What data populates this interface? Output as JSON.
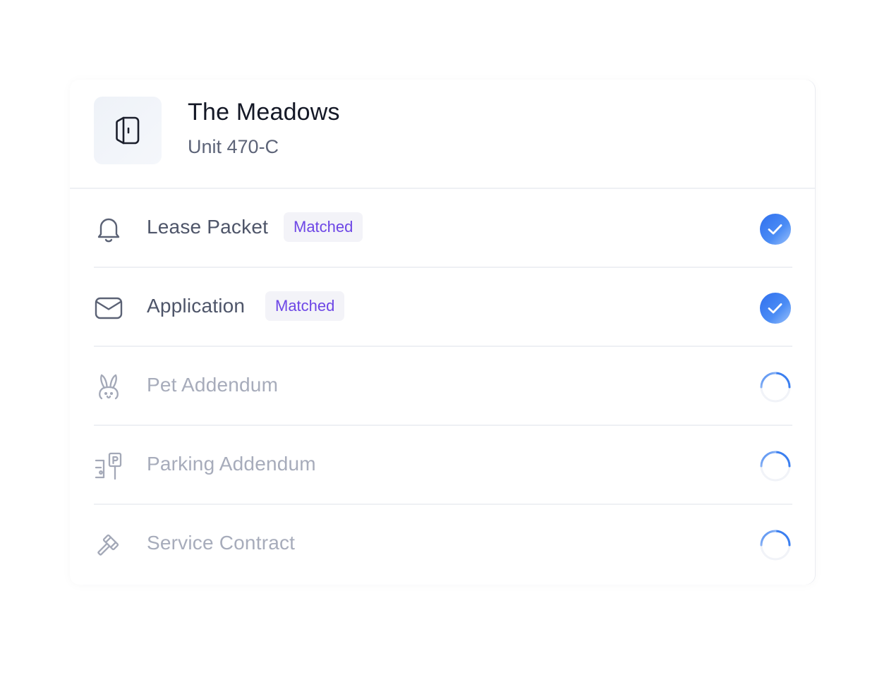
{
  "property": {
    "name": "The Meadows",
    "unit": "Unit 470-C",
    "icon": "door-icon"
  },
  "documents": [
    {
      "label": "Lease Packet",
      "icon": "bell-icon",
      "badge": "Matched",
      "status": "complete"
    },
    {
      "label": "Application",
      "icon": "envelope-icon",
      "badge": "Matched",
      "status": "complete"
    },
    {
      "label": "Pet Addendum",
      "icon": "rabbit-icon",
      "status": "loading"
    },
    {
      "label": "Parking Addendum",
      "icon": "parking-icon",
      "status": "loading"
    },
    {
      "label": "Service Contract",
      "icon": "gavel-icon",
      "status": "loading"
    }
  ],
  "colors": {
    "accent_blue": "#3b7ff0",
    "badge_text": "#6d46e6",
    "badge_bg": "#f3f3f8"
  }
}
